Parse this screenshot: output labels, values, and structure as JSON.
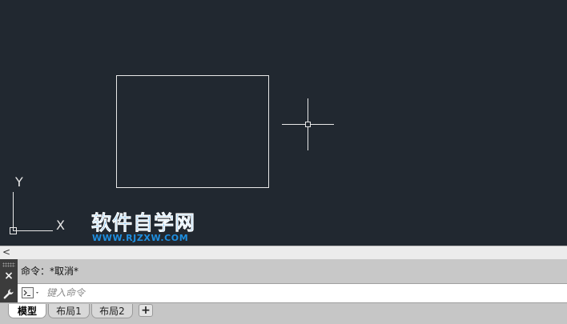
{
  "canvas": {
    "background": "#212830",
    "ucs": {
      "y_label": "Y",
      "x_label": "X"
    }
  },
  "watermark": {
    "text": "软件自学网",
    "url": "WWW.RJZXW.COM",
    "color": "#1f8fe0"
  },
  "scroll": {
    "left_arrow": "<"
  },
  "command": {
    "history_line": "命令：*取消*",
    "input_placeholder": "键入命令",
    "close_glyph": "×"
  },
  "layout_tabs": {
    "tabs": [
      {
        "label": "模型",
        "active": true
      },
      {
        "label": "布局1",
        "active": false
      },
      {
        "label": "布局2",
        "active": false
      }
    ],
    "add_label": "+"
  }
}
